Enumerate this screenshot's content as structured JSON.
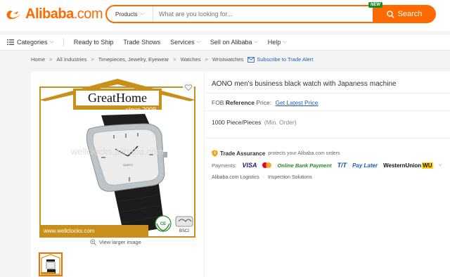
{
  "header": {
    "logo_text": "Alibaba",
    "logo_suffix": ".com",
    "search_category": "Products",
    "search_placeholder": "What are you looking for...",
    "new_badge": "NEW",
    "search_button": "Search",
    "accent_color": "#ff6a00"
  },
  "nav": {
    "items": [
      {
        "label": "Categories",
        "icon": "menu-icon",
        "dropdown": true
      },
      {
        "label": "Ready to Ship",
        "dropdown": false
      },
      {
        "label": "Trade Shows",
        "dropdown": false
      },
      {
        "label": "Services",
        "dropdown": true
      },
      {
        "label": "Sell on Alibaba",
        "dropdown": true
      },
      {
        "label": "Help",
        "dropdown": true
      }
    ]
  },
  "breadcrumb": {
    "items": [
      "Home",
      "All Industries",
      "Timepieces, Jewelry, Eyewear",
      "Watches",
      "Wristwatches"
    ],
    "subscribe": "Subscribe to Trade Alert"
  },
  "product": {
    "image": {
      "brand": "GreatHome",
      "since": "since 2008",
      "watermark": "wellclocks.alibaba.com",
      "website": "www.wellclocks.com",
      "cert_label": "BSCI",
      "seal_label": "CE"
    },
    "view_larger": "View larger image",
    "title": "AONO men's business black watch with Japaness machine",
    "fob_prefix": "FOB",
    "fob_reference": "Reference",
    "fob_price_label": "Price:",
    "fob_link": "Get Latest Price",
    "moq_value": "1000 Piece/Pieces",
    "moq_label": "(Min. Order)",
    "trade_assurance": "Trade Assurance",
    "trade_assurance_desc": "protects your Alibaba.com orders",
    "payments_label": "Payments:",
    "payments": [
      "VISA",
      "Online Bank Payment",
      "T/T",
      "Pay Later",
      "WesternUnion"
    ],
    "wu_suffix": "WU",
    "logistics": "Alibaba.com Logistics",
    "inspection": "Inspection Solutions"
  }
}
